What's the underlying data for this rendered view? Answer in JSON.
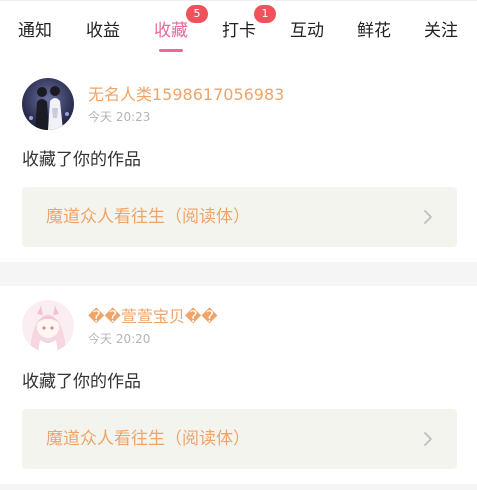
{
  "tabs": [
    {
      "label": "通知",
      "badge": ""
    },
    {
      "label": "收益",
      "badge": ""
    },
    {
      "label": "收藏",
      "badge": "5"
    },
    {
      "label": "打卡",
      "badge": "1"
    },
    {
      "label": "互动",
      "badge": ""
    },
    {
      "label": "鲜花",
      "badge": ""
    },
    {
      "label": "关注",
      "badge": ""
    }
  ],
  "active_tab": "收藏",
  "colors": {
    "accent": "#e8699a",
    "badge": "#f0525c",
    "username": "#f0a46a",
    "work_title": "#f0a46a",
    "work_bg": "#f4f4ee"
  },
  "notifications": [
    {
      "username": "无名人类1598617056983",
      "time": "今天 20:23",
      "action": "收藏了你的作品",
      "work_title": "魔道众人看往生（阅读体）",
      "avatar_icon": "dark-artwork-avatar"
    },
    {
      "username": "��萱萱宝贝��",
      "time": "今天 20:20",
      "action": "收藏了你的作品",
      "work_title": "魔道众人看往生（阅读体）",
      "avatar_icon": "pink-anime-girl-avatar"
    }
  ]
}
